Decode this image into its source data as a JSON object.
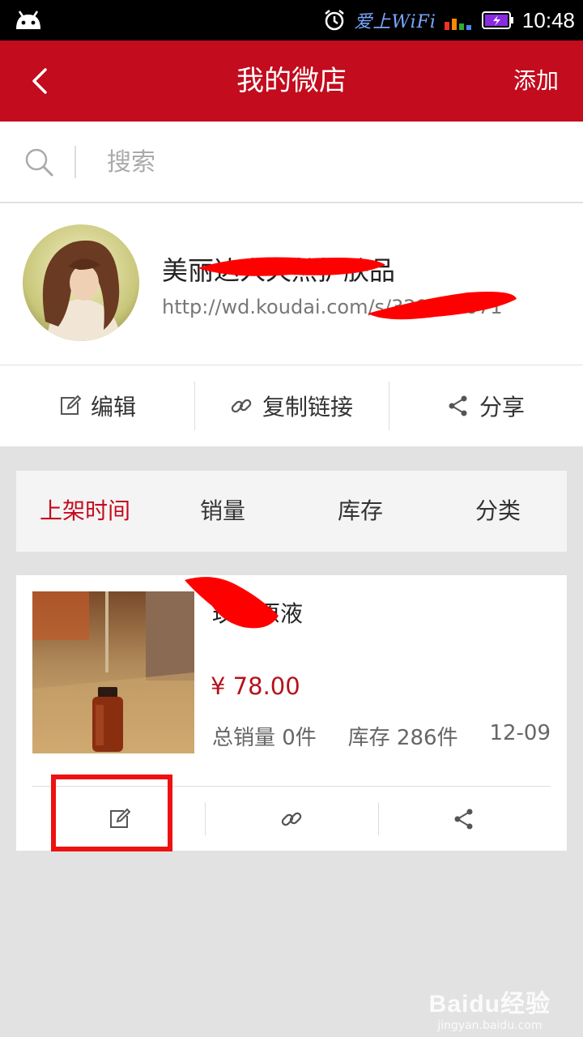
{
  "status_bar": {
    "wifi_label": "爱上WiFi",
    "clock": "10:48"
  },
  "header": {
    "title": "我的微店",
    "add_label": "添加"
  },
  "search": {
    "placeholder": "搜索"
  },
  "shop": {
    "name": "美丽达人天然护肤品",
    "url": "http://wd.koudai.com/s/329529071"
  },
  "shop_actions": [
    {
      "label": "编辑",
      "icon": "edit-icon"
    },
    {
      "label": "复制链接",
      "icon": "link-icon"
    },
    {
      "label": "分享",
      "icon": "share-icon"
    }
  ],
  "sort_tabs": [
    {
      "label": "上架时间",
      "active": true
    },
    {
      "label": "销量"
    },
    {
      "label": "库存"
    },
    {
      "label": "分类"
    }
  ],
  "product": {
    "name": "玫瑰原液",
    "price": "¥ 78.00",
    "sales": "总销量 0件",
    "stock": "库存 286件",
    "date": "12-09"
  },
  "colors": {
    "brand_red": "#c30c1e",
    "price_red": "#b5121b",
    "highlight": "#ee1111"
  },
  "watermark": {
    "brand": "Baidu经验",
    "domain": "jingyan.baidu.com"
  }
}
